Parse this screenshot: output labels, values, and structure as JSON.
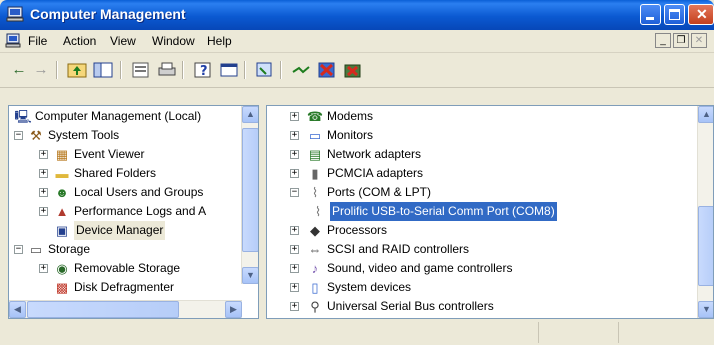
{
  "window": {
    "title": "Computer Management",
    "minimize": "_",
    "maximize": "□",
    "close": "✕"
  },
  "menu": {
    "items": [
      "File",
      "Action",
      "View",
      "Window",
      "Help"
    ],
    "mdi_min": "_",
    "mdi_restore": "❐",
    "mdi_close": "✕"
  },
  "toolbar": {
    "back_icon": "←",
    "forward_icon": "→",
    "icons": [
      "up-folder-icon",
      "show-tree-icon",
      "properties-icon",
      "print-icon",
      "help-icon",
      "console-icon",
      "scan-hardware-icon",
      "disable-icon",
      "uninstall-icon",
      "update-driver-icon"
    ]
  },
  "left_tree": [
    {
      "label": "Computer Management (Local)",
      "icon": "computer-icon",
      "expander": ""
    },
    {
      "label": "System Tools",
      "icon": "tools-icon",
      "expander": "−"
    },
    {
      "label": "Event Viewer",
      "icon": "event-viewer-icon",
      "expander": "+"
    },
    {
      "label": "Shared Folders",
      "icon": "folder-icon",
      "expander": "+"
    },
    {
      "label": "Local Users and Groups",
      "icon": "users-icon",
      "expander": "+"
    },
    {
      "label": "Performance Logs and A",
      "icon": "performance-icon",
      "expander": "+"
    },
    {
      "label": "Device Manager",
      "icon": "device-manager-icon",
      "expander": ""
    },
    {
      "label": "Storage",
      "icon": "storage-icon",
      "expander": "−"
    },
    {
      "label": "Removable Storage",
      "icon": "removable-storage-icon",
      "expander": "+"
    },
    {
      "label": "Disk Defragmenter",
      "icon": "defrag-icon",
      "expander": ""
    }
  ],
  "right_tree": [
    {
      "label": "Modems",
      "icon": "modem-icon",
      "expander": "+"
    },
    {
      "label": "Monitors",
      "icon": "monitor-icon",
      "expander": "+"
    },
    {
      "label": "Network adapters",
      "icon": "network-adapter-icon",
      "expander": "+"
    },
    {
      "label": "PCMCIA adapters",
      "icon": "pcmcia-icon",
      "expander": "+"
    },
    {
      "label": "Ports (COM & LPT)",
      "icon": "port-icon",
      "expander": "−"
    },
    {
      "label": "Prolific USB-to-Serial Comm Port (COM8)",
      "icon": "port-icon",
      "expander": ""
    },
    {
      "label": "Processors",
      "icon": "processor-icon",
      "expander": "+"
    },
    {
      "label": "SCSI and RAID controllers",
      "icon": "scsi-icon",
      "expander": "+"
    },
    {
      "label": "Sound, video and game controllers",
      "icon": "sound-icon",
      "expander": "+"
    },
    {
      "label": "System devices",
      "icon": "system-device-icon",
      "expander": "+"
    },
    {
      "label": "Universal Serial Bus controllers",
      "icon": "usb-icon",
      "expander": "+"
    }
  ],
  "selection": {
    "left": "Device Manager",
    "right": "Prolific USB-to-Serial Comm Port (COM8)"
  },
  "colors": {
    "titlebar": "#0b59d1",
    "selection": "#316ac5",
    "background": "#ece9d8"
  }
}
